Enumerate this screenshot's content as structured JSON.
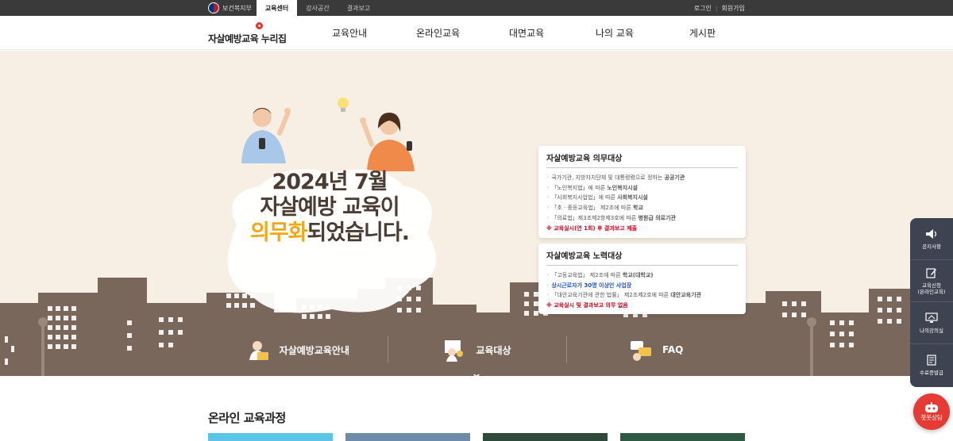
{
  "topbar": {
    "gov_label": "보건복지부",
    "tabs": [
      {
        "label": "교육센터",
        "active": true
      },
      {
        "label": "강사공간",
        "active": false
      },
      {
        "label": "결과보고",
        "active": false
      }
    ],
    "login": "로그인",
    "join": "회원가입"
  },
  "header": {
    "logo_text": "자살예방교육 누리집",
    "nav": [
      "교육안내",
      "온라인교육",
      "대면교육",
      "나의 교육",
      "게시판"
    ]
  },
  "hero": {
    "slogan_line1": "2024년 7월",
    "slogan_line2": "자살예방 교육이",
    "slogan_highlight": "의무화",
    "slogan_line3_rest": "되었습니다."
  },
  "duty_card": {
    "title": "자살예방교육 의무대상",
    "items": [
      {
        "text": "국가기관, 지방자치단체 및 대통령령으로 정하는 ",
        "bold": "공공기관"
      },
      {
        "text": "「노인복지법」에 따른 ",
        "bold": "노인복지시설"
      },
      {
        "text": "「사회복지사업법」에 따른 ",
        "bold": "사회복지시설"
      },
      {
        "text": "「초 · 중등교육법」 제2조에 따른 ",
        "bold": "학교"
      },
      {
        "text": "「의료법」제3조제2항제3호에 따른 ",
        "bold": "병원급 의료기관"
      }
    ],
    "note": "※ 교육실시(연 1회) 후 결과보고 제출"
  },
  "effort_card": {
    "title": "자살예방교육 노력대상",
    "items": [
      {
        "text": "「고등교육법」 제2조에 따른 ",
        "bold": "학교(대학교)"
      },
      {
        "text": "",
        "blue": "상시근로자가 30명 이상인 사업장"
      },
      {
        "text": "「대안교육기관에 관한 법률」 제2조제2호에 따른 ",
        "bold": "대안교육기관"
      }
    ],
    "note": "※ 교육실시 및 결과보고 의무 없음"
  },
  "quick_links": [
    "자살예방교육안내",
    "교육대상",
    "FAQ"
  ],
  "side_menu": [
    {
      "label": "공지사항",
      "icon": "speaker-icon"
    },
    {
      "label": "교육신청\n(온라인교육)",
      "icon": "edit-icon"
    },
    {
      "label": "나의강의실",
      "icon": "monitor-icon"
    },
    {
      "label": "수료증발급",
      "icon": "certificate-icon"
    }
  ],
  "chatbot_label": "챗봇상담",
  "section": {
    "title": "온라인 교육과정"
  },
  "colors": {
    "hero_bg": "#f8efe4",
    "building": "#7a675b",
    "accent": "#f2a71b",
    "side_menu": "#3d4350",
    "chatbot": "#e53b34"
  }
}
